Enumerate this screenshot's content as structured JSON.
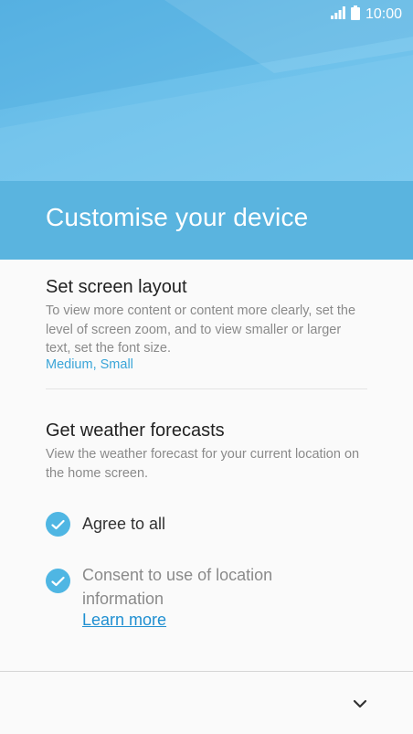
{
  "status_bar": {
    "time": "10:00",
    "icons": [
      "signal-icon",
      "battery-icon"
    ]
  },
  "header": {
    "title": "Customise your device"
  },
  "screen_layout": {
    "title": "Set screen layout",
    "description": "To view more content or content more clearly, set the level of screen zoom, and to view smaller or larger text, set the font size.",
    "value": "Medium, Small"
  },
  "weather": {
    "title": "Get weather forecasts",
    "description": "View the weather forecast for your current location on the home screen.",
    "agree_all": "Agree to all",
    "consent_location": "Consent to use of location information",
    "learn_more": "Learn more"
  },
  "colors": {
    "accent": "#4fb6e3",
    "title_band": "#5ab4df",
    "link": "#1f8fd1"
  },
  "footer": {
    "next_icon": "chevron-down-icon"
  }
}
